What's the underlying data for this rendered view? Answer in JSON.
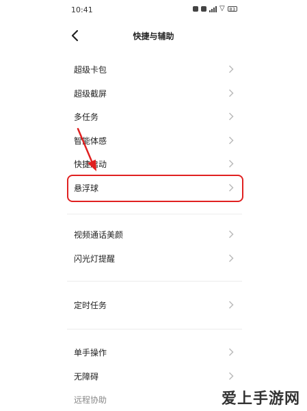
{
  "status_bar": {
    "time": "10:41",
    "battery": "83"
  },
  "header": {
    "title": "快捷与辅助"
  },
  "section_1": {
    "items": [
      {
        "label": "超级卡包"
      },
      {
        "label": "超级截屏"
      },
      {
        "label": "多任务"
      },
      {
        "label": "智能体感"
      },
      {
        "label": "快捷启动"
      },
      {
        "label": "悬浮球"
      }
    ]
  },
  "section_2": {
    "items": [
      {
        "label": "视频通话美颜"
      },
      {
        "label": "闪光灯提醒"
      }
    ]
  },
  "section_3": {
    "items": [
      {
        "label": "定时任务"
      }
    ]
  },
  "section_4": {
    "items": [
      {
        "label": "单手操作"
      },
      {
        "label": "无障碍"
      },
      {
        "label": "远程协助"
      }
    ]
  },
  "watermark": "爱上手游网",
  "colors": {
    "highlight": "#e02020",
    "chevron": "#bbbbbb"
  }
}
